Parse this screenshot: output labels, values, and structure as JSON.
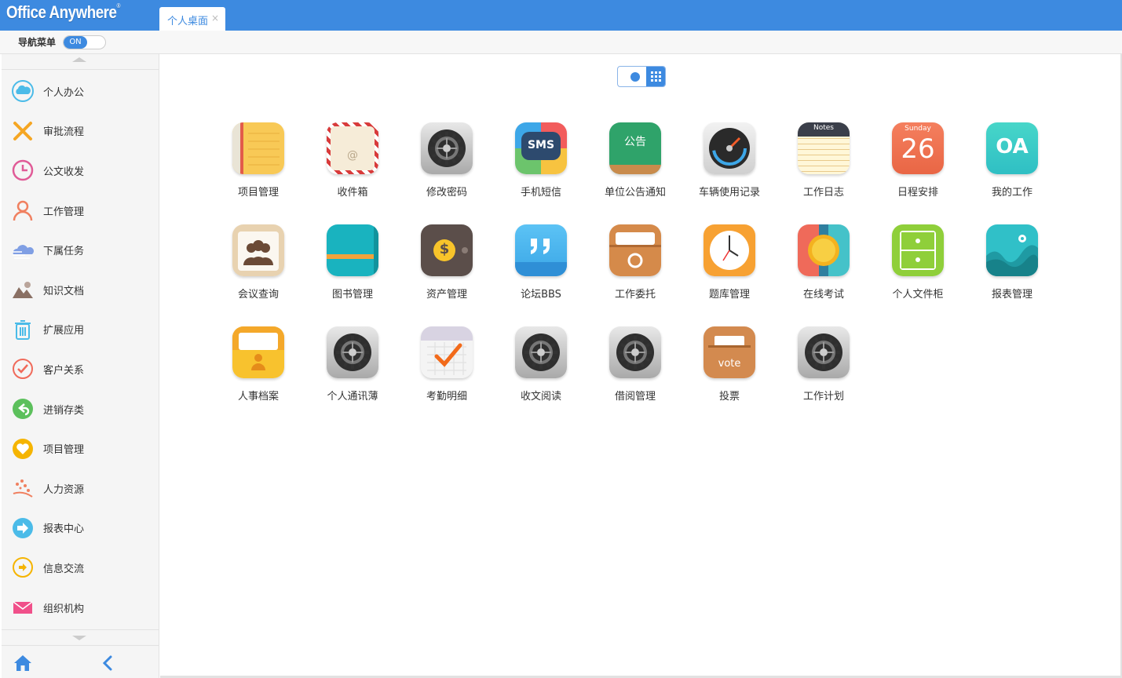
{
  "header": {
    "logo": "Office Anywhere",
    "logo_mark": "®",
    "tab_label": "个人桌面",
    "tab_close": "×"
  },
  "subbar": {
    "nav_label": "导航菜单",
    "toggle_label": "ON"
  },
  "sidebar": {
    "items": [
      {
        "label": "个人办公",
        "icon": "cloud-110-icon",
        "color": "#4bbbe8"
      },
      {
        "label": "审批流程",
        "icon": "cross-icon",
        "color": "#f5a623"
      },
      {
        "label": "公文收发",
        "icon": "clock-icon",
        "color": "#e05b97"
      },
      {
        "label": "工作管理",
        "icon": "person-icon",
        "color": "#f08060"
      },
      {
        "label": "下属任务",
        "icon": "cloud-lines-icon",
        "color": "#6b8fe0"
      },
      {
        "label": "知识文档",
        "icon": "mountain-cloud-icon",
        "color": "#8a7064"
      },
      {
        "label": "扩展应用",
        "icon": "trash-icon",
        "color": "#4bbbe8"
      },
      {
        "label": "客户关系",
        "icon": "check-circle-icon",
        "color": "#f06a5a"
      },
      {
        "label": "进销存类",
        "icon": "reply-circle-icon",
        "color": "#5cc05c"
      },
      {
        "label": "项目管理",
        "icon": "heart-circle-icon",
        "color": "#f5b400"
      },
      {
        "label": "人力资源",
        "icon": "dots-spray-icon",
        "color": "#f08060"
      },
      {
        "label": "报表中心",
        "icon": "arrow-circle-icon",
        "color": "#4bbbe8"
      },
      {
        "label": "信息交流",
        "icon": "arrow-ring-icon",
        "color": "#f5b400"
      },
      {
        "label": "组织机构",
        "icon": "envelope-icon",
        "color": "#f0508a"
      }
    ]
  },
  "apps": [
    {
      "label": "项目管理",
      "icon": "notebook-icon"
    },
    {
      "label": "收件箱",
      "icon": "mail-envelope-icon",
      "glyph": "@"
    },
    {
      "label": "修改密码",
      "icon": "settings-gear-icon"
    },
    {
      "label": "手机短信",
      "icon": "sms-icon",
      "glyph": "SMS"
    },
    {
      "label": "单位公告通知",
      "icon": "blackboard-icon",
      "glyph": "公告"
    },
    {
      "label": "车辆使用记录",
      "icon": "speedometer-icon"
    },
    {
      "label": "工作日志",
      "icon": "notes-icon",
      "glyph": "Notes"
    },
    {
      "label": "日程安排",
      "icon": "calendar-icon",
      "glyph": "Sunday",
      "glyph2": "26"
    },
    {
      "label": "我的工作",
      "icon": "oa-icon",
      "glyph": "OA"
    },
    {
      "label": "会议查询",
      "icon": "meeting-icon"
    },
    {
      "label": "图书管理",
      "icon": "book-icon"
    },
    {
      "label": "资产管理",
      "icon": "wallet-icon",
      "glyph": "$"
    },
    {
      "label": "论坛BBS",
      "icon": "quote-bubble-icon"
    },
    {
      "label": "工作委托",
      "icon": "archive-box-icon"
    },
    {
      "label": "题库管理",
      "icon": "clock-face-icon"
    },
    {
      "label": "在线考试",
      "icon": "medal-icon"
    },
    {
      "label": "个人文件柜",
      "icon": "cabinet-icon"
    },
    {
      "label": "报表管理",
      "icon": "chart-wave-icon"
    },
    {
      "label": "人事档案",
      "icon": "personnel-folder-icon"
    },
    {
      "label": "个人通讯薄",
      "icon": "settings-gear-icon"
    },
    {
      "label": "考勤明细",
      "icon": "attendance-calendar-icon"
    },
    {
      "label": "收文阅读",
      "icon": "settings-gear-icon"
    },
    {
      "label": "借阅管理",
      "icon": "settings-gear-icon"
    },
    {
      "label": "投票",
      "icon": "vote-box-icon",
      "glyph": "vote"
    },
    {
      "label": "工作计划",
      "icon": "settings-gear-icon"
    }
  ],
  "colors": {
    "brand": "#3d8ae0",
    "sidebar_bg": "#f5f5f5"
  }
}
